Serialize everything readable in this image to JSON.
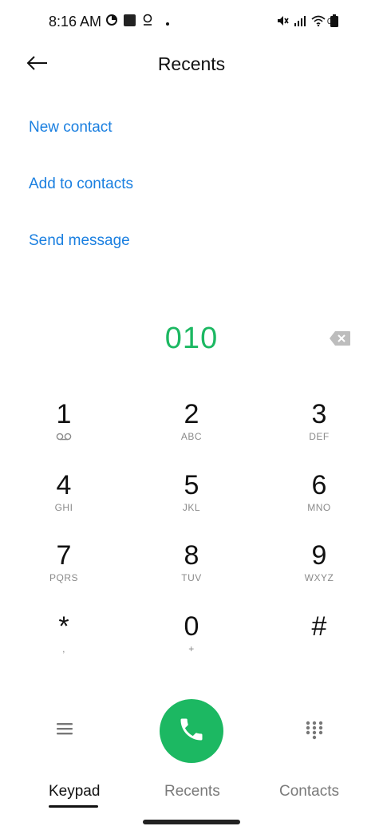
{
  "status_bar": {
    "time": "8:16 AM",
    "battery": "00",
    "icons": [
      "data-saver-icon",
      "stop-icon",
      "location-icon",
      "dot-icon",
      "mute-icon",
      "signal-icon",
      "wifi-icon",
      "battery-icon"
    ]
  },
  "header": {
    "title": "Recents",
    "back_icon": "back-arrow-icon"
  },
  "actions": {
    "new_contact": "New contact",
    "add_to_contacts": "Add to contacts",
    "send_message": "Send message"
  },
  "dialed_number": "010",
  "colors": {
    "accent_blue": "#1a7fe0",
    "call_green": "#1cb862"
  },
  "keypad": [
    {
      "digit": "1",
      "letters": ""
    },
    {
      "digit": "2",
      "letters": "ABC"
    },
    {
      "digit": "3",
      "letters": "DEF"
    },
    {
      "digit": "4",
      "letters": "GHI"
    },
    {
      "digit": "5",
      "letters": "JKL"
    },
    {
      "digit": "6",
      "letters": "MNO"
    },
    {
      "digit": "7",
      "letters": "PQRS"
    },
    {
      "digit": "8",
      "letters": "TUV"
    },
    {
      "digit": "9",
      "letters": "WXYZ"
    },
    {
      "digit": "*",
      "letters": ","
    },
    {
      "digit": "0",
      "letters": "+"
    },
    {
      "digit": "#",
      "letters": ""
    }
  ],
  "tabs": [
    {
      "label": "Keypad",
      "active": true
    },
    {
      "label": "Recents",
      "active": false
    },
    {
      "label": "Contacts",
      "active": false
    }
  ]
}
